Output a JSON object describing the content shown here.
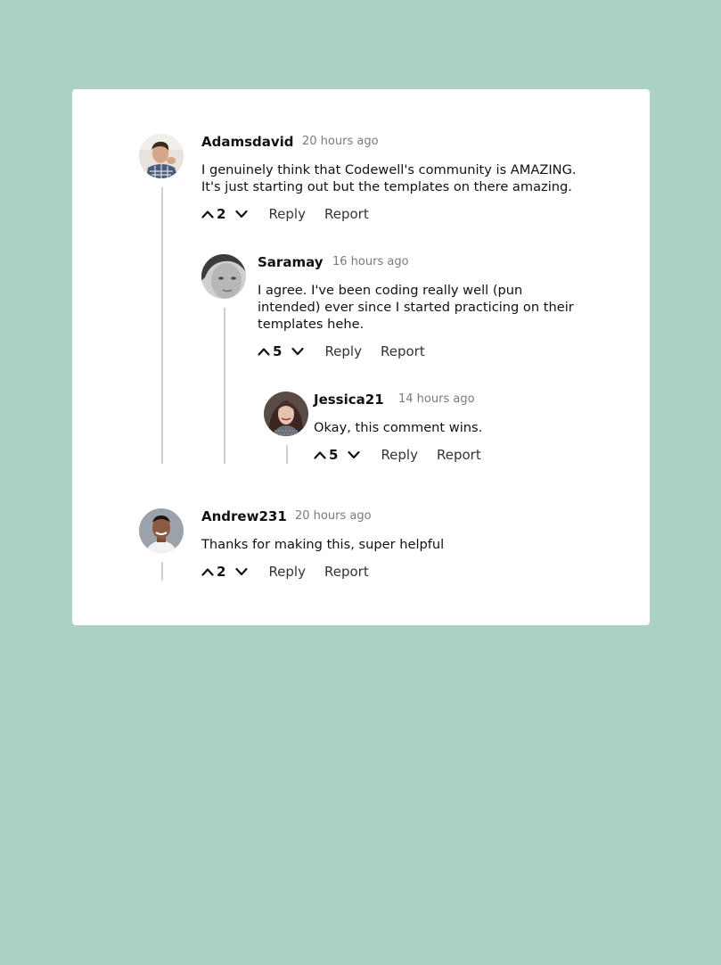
{
  "comments": [
    {
      "username": "Adamsdavid",
      "time": "20 hours ago",
      "text": "I genuinely think that Codewell's community is AMAZING. It's just starting out but the templates on there amazing.",
      "votes": "2",
      "reply_label": "Reply",
      "report_label": "Report"
    },
    {
      "username": "Saramay",
      "time": "16 hours ago",
      "text": "I agree. I've been coding really well (pun intended) ever since I started practicing on their templates hehe.",
      "votes": "5",
      "reply_label": "Reply",
      "report_label": "Report"
    },
    {
      "username": "Jessica21",
      "time": "14 hours ago",
      "text": "Okay, this comment wins.",
      "votes": "5",
      "reply_label": "Reply",
      "report_label": "Report"
    },
    {
      "username": "Andrew231",
      "time": "20 hours ago",
      "text": "Thanks for making this, super helpful",
      "votes": "2",
      "reply_label": "Reply",
      "report_label": "Report"
    }
  ],
  "icons": {
    "upvote": "chevron-up-icon",
    "downvote": "chevron-down-icon"
  },
  "colors": {
    "background": "#acd2c7",
    "card": "#ffffff",
    "thread_line": "#cfcfcf",
    "timestamp": "#7a7a7a"
  }
}
